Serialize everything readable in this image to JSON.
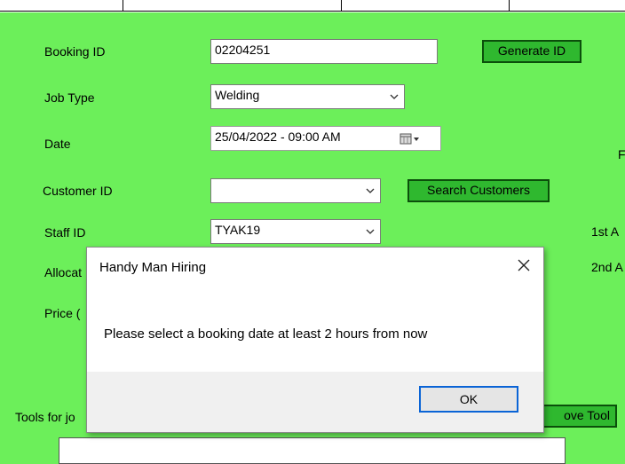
{
  "form": {
    "booking_id_label": "Booking ID",
    "booking_id_value": "02204251",
    "generate_id_label": "Generate ID",
    "job_type_label": "Job Type",
    "job_type_value": "Welding",
    "date_label": "Date",
    "date_value": "25/04/2022 - 09:00 AM",
    "customer_id_label": "Customer ID",
    "customer_id_value": "",
    "search_customers_label": "Search Customers",
    "staff_id_label": "Staff ID",
    "staff_id_value": "TYAK19",
    "allocated_label_partial": "Allocat",
    "price_label_partial": "Price (",
    "tools_label_partial": "Tools for jo",
    "remove_tool_label_partial": "ove Tool",
    "right_partial_1": "F",
    "right_partial_2": "1st A",
    "right_partial_3": "2nd A"
  },
  "dialog": {
    "title": "Handy Man Hiring",
    "message": "Please select a booking date at least 2 hours from now",
    "ok_label": "OK"
  },
  "colors": {
    "background": "#6cef5a",
    "button_green": "#2fb82f",
    "ok_focus": "#0a64d6"
  }
}
